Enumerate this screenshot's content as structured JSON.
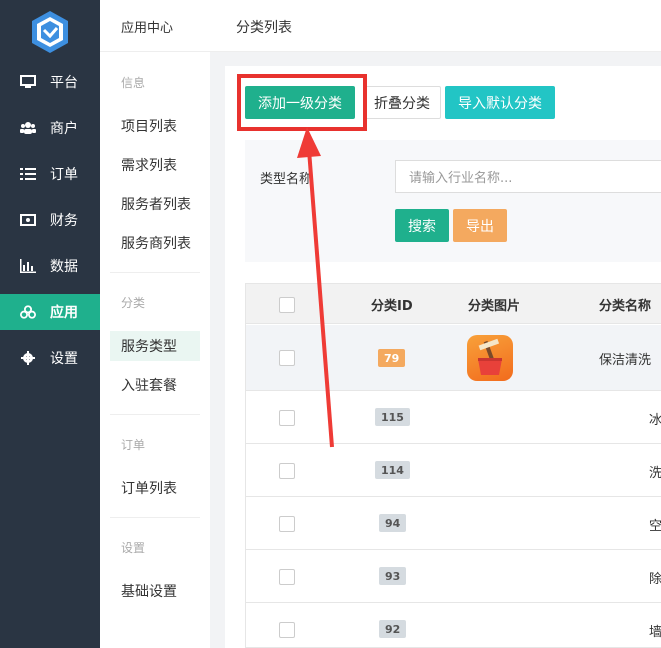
{
  "sidebar": {
    "items": [
      {
        "label": "平台",
        "icon": "monitor-icon"
      },
      {
        "label": "商户",
        "icon": "users-icon"
      },
      {
        "label": "订单",
        "icon": "list-icon"
      },
      {
        "label": "财务",
        "icon": "money-icon"
      },
      {
        "label": "数据",
        "icon": "bar-chart-icon"
      },
      {
        "label": "应用",
        "icon": "apps-icon",
        "active": true
      },
      {
        "label": "设置",
        "icon": "gear-icon"
      }
    ]
  },
  "submenu": {
    "title": "应用中心",
    "groups": [
      {
        "label": "信息",
        "items": [
          "项目列表",
          "需求列表",
          "服务者列表",
          "服务商列表"
        ]
      },
      {
        "label": "分类",
        "items": [
          "服务类型",
          "入驻套餐"
        ]
      },
      {
        "label": "订单",
        "items": [
          "订单列表"
        ]
      },
      {
        "label": "设置",
        "items": [
          "基础设置"
        ]
      }
    ]
  },
  "header": {
    "title": "分类列表"
  },
  "toolbar": {
    "add_label": "添加一级分类",
    "collapse_label": "折叠分类",
    "import_label": "导入默认分类"
  },
  "search": {
    "label": "类型名称",
    "placeholder": "请输入行业名称...",
    "search_label": "搜索",
    "export_label": "导出"
  },
  "table": {
    "columns": [
      "分类ID",
      "分类图片",
      "分类名称"
    ],
    "rows": [
      {
        "id": "79",
        "name": "保洁清洗"
      },
      {
        "id": "115",
        "name": "冰"
      },
      {
        "id": "114",
        "name": "洗"
      },
      {
        "id": "94",
        "name": "空"
      },
      {
        "id": "93",
        "name": "除"
      },
      {
        "id": "92",
        "name": "墙"
      }
    ]
  },
  "colors": {
    "accent": "#1fb08d",
    "nav_bg": "#2a3543",
    "highlight": "#e8322e"
  }
}
